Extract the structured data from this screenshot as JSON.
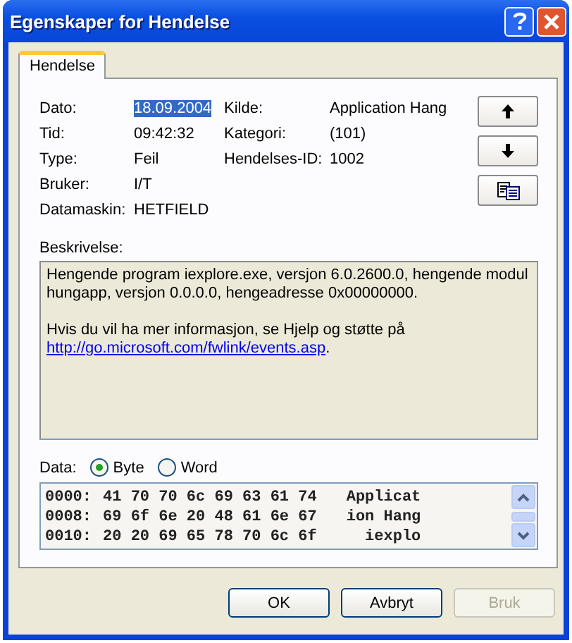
{
  "window": {
    "title": "Egenskaper for Hendelse"
  },
  "tabs": [
    {
      "label": "Hendelse",
      "selected": true
    }
  ],
  "fields": [
    [
      {
        "label": "Dato:",
        "value": "18.09.2004",
        "selected": true
      },
      {
        "label": "Tid:",
        "value": "09:42:32",
        "selected": false
      },
      {
        "label": "Type:",
        "value": "Feil",
        "selected": false
      },
      {
        "label": "Bruker:",
        "value": "I/T",
        "selected": false
      },
      {
        "label": "Datamaskin:",
        "value": "HETFIELD",
        "selected": false
      }
    ],
    [
      {
        "label": "Kilde:",
        "value": "Application Hang",
        "selected": false
      },
      {
        "label": "Kategori:",
        "value": "(101)",
        "selected": false
      },
      {
        "label": "Hendelses-ID:",
        "value": "1002",
        "selected": false
      }
    ]
  ],
  "side_buttons": [
    {
      "kind": "up"
    },
    {
      "kind": "down"
    },
    {
      "kind": "copy"
    }
  ],
  "description": {
    "label": "Beskrivelse:",
    "paragraphs": [
      {
        "text": "Hengende program iexplore.exe, versjon 6.0.2600.0, hengende modul hungapp, versjon 0.0.0.0, hengeadresse 0x00000000."
      },
      {
        "text": "Hvis du vil ha mer informasjon, se Hjelp og støtte på",
        "link": "http://go.microsoft.com/fwlink/events.asp",
        "after": "."
      }
    ]
  },
  "data": {
    "label": "Data:",
    "options": [
      {
        "label": "Byte",
        "selected": true
      },
      {
        "label": "Word",
        "selected": false
      }
    ],
    "rows": [
      {
        "offset": "0000:",
        "bytes": "41 70 70 6c 69 63 61 74",
        "text": "Applicat"
      },
      {
        "offset": "0008:",
        "bytes": "69 6f 6e 20 48 61 6e 67",
        "text": "ion Hang"
      },
      {
        "offset": "0010:",
        "bytes": "20 20 69 65 78 70 6c 6f",
        "text": "  iexplo"
      }
    ]
  },
  "buttons": [
    {
      "label": "OK",
      "disabled": false
    },
    {
      "label": "Avbryt",
      "disabled": false
    },
    {
      "label": "Bruk",
      "disabled": true
    }
  ]
}
